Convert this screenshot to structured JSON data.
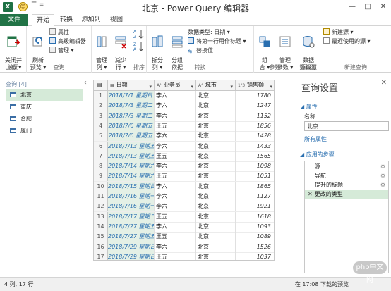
{
  "window": {
    "title": "北京 - Power Query 编辑器",
    "qat": "☰ =",
    "btn_min": "—",
    "btn_max": "□",
    "btn_close": "✕",
    "app_icon_text": "X"
  },
  "tabs": [
    "文件",
    "开始",
    "转换",
    "添加列",
    "视图"
  ],
  "ribbon": {
    "close": {
      "btn": "关闭并\n上载 ▾",
      "group": "关闭"
    },
    "query": {
      "refresh": "刷新\n预览 ▾",
      "props": "属性",
      "adv": "高级编辑器",
      "manage": "管理 ▾",
      "group": "查询"
    },
    "cols": {
      "manage": "管理\n列 ▾",
      "reduce": "减少\n行 ▾"
    },
    "sort": {
      "group": "排序"
    },
    "transform": {
      "split": "拆分\n列 ▾",
      "groupby": "分组\n依据",
      "dtype": "数据类型: 日期 ▾",
      "header": "将第一行用作标题 ▾",
      "replace": "替换值",
      "group": "转换"
    },
    "params": {
      "combine": "组\n合 ▾",
      "manage": "管理\n参数 ▾",
      "group": "参数"
    },
    "source": {
      "settings": "数据\n源设置",
      "group": "数据源"
    },
    "newq": {
      "new": "新建源 ▾",
      "recent": "最近使用的源 ▾",
      "group": "新建查询"
    }
  },
  "queries": {
    "header": "查询 [4]",
    "items": [
      "北京",
      "重庆",
      "合肥",
      "厦门"
    ],
    "collapse": "‹"
  },
  "grid": {
    "columns": [
      {
        "type": "▦",
        "name": "日期"
      },
      {
        "type": "Aᴬ",
        "name": "业务员"
      },
      {
        "type": "Aᴬ",
        "name": "城市"
      },
      {
        "type": "1²3",
        "name": "销售额"
      }
    ],
    "rows": [
      [
        "1",
        "2018/7/1 星期日",
        "李六",
        "北京",
        "1780"
      ],
      [
        "2",
        "2018/7/3 星期二",
        "李六",
        "北京",
        "1247"
      ],
      [
        "3",
        "2018/7/3 星期二",
        "李六",
        "北京",
        "1152"
      ],
      [
        "4",
        "2018/7/6 星期五",
        "王五",
        "北京",
        "1856"
      ],
      [
        "5",
        "2018/7/6 星期五",
        "李六",
        "北京",
        "1428"
      ],
      [
        "6",
        "2018/7/13 星期五",
        "李六",
        "北京",
        "1433"
      ],
      [
        "7",
        "2018/7/13 星期五",
        "王五",
        "北京",
        "1565"
      ],
      [
        "8",
        "2018/7/14 星期六",
        "李六",
        "北京",
        "1098"
      ],
      [
        "9",
        "2018/7/14 星期六",
        "王五",
        "北京",
        "1051"
      ],
      [
        "10",
        "2018/7/15 星期日",
        "李六",
        "北京",
        "1865"
      ],
      [
        "11",
        "2018/7/16 星期一",
        "李六",
        "北京",
        "1127"
      ],
      [
        "12",
        "2018/7/16 星期一",
        "李六",
        "北京",
        "1921"
      ],
      [
        "13",
        "2018/7/17 星期二",
        "王五",
        "北京",
        "1618"
      ],
      [
        "14",
        "2018/7/27 星期五",
        "李六",
        "北京",
        "1093"
      ],
      [
        "15",
        "2018/7/27 星期五",
        "王五",
        "北京",
        "1089"
      ],
      [
        "16",
        "2018/7/29 星期日",
        "李六",
        "北京",
        "1526"
      ],
      [
        "17",
        "2018/7/29 星期日",
        "王五",
        "北京",
        "1037"
      ]
    ]
  },
  "settings": {
    "title": "查询设置",
    "close": "✕",
    "props_header": "◢ 属性",
    "name_label": "名称",
    "name_value": "北京",
    "all_props": "所有属性",
    "steps_header": "◢ 应用的步骤",
    "steps": [
      "源",
      "导航",
      "提升的标题",
      "更改的类型"
    ],
    "gear": "⚙",
    "delete_step": "✕"
  },
  "status": {
    "left": "4 列, 17 行",
    "right": "在 17:08 下载的预览"
  },
  "watermark": "php中文网",
  "colors": {
    "excel_green": "#217346",
    "accent_blue": "#2a6fb0",
    "selection_green": "#d5ead8"
  }
}
